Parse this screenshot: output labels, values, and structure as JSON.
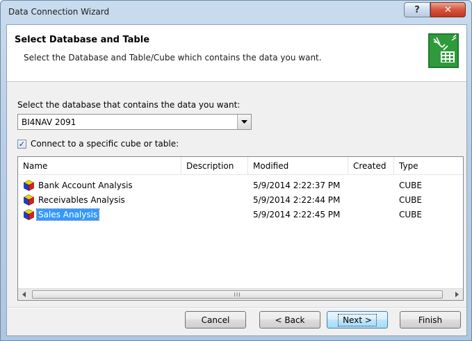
{
  "window": {
    "title": "Data Connection Wizard",
    "help_glyph": "?",
    "close_glyph": "✕"
  },
  "header": {
    "title": "Select Database and Table",
    "subtitle": "Select the Database and Table/Cube which contains the data you want."
  },
  "database": {
    "label": "Select the database that contains the data you want:",
    "selected_value": "BI4NAV 2091"
  },
  "connect_checkbox": {
    "label": "Connect to a specific cube or table:",
    "checked": true,
    "check_glyph": "✓"
  },
  "list": {
    "columns": {
      "name": "Name",
      "description": "Description",
      "modified": "Modified",
      "created": "Created",
      "type": "Type"
    },
    "rows": [
      {
        "name": "Bank Account Analysis",
        "description": "",
        "modified": "5/9/2014 2:22:37 PM",
        "created": "",
        "type": "CUBE"
      },
      {
        "name": "Receivables Analysis",
        "description": "",
        "modified": "5/9/2014 2:22:44 PM",
        "created": "",
        "type": "CUBE"
      },
      {
        "name": "Sales Analysis",
        "description": "",
        "modified": "5/9/2014 2:22:45 PM",
        "created": "",
        "type": "CUBE",
        "selected": true
      }
    ],
    "scroll_grip": "III"
  },
  "buttons": {
    "cancel": "Cancel",
    "back": "< Back",
    "next": "Next >",
    "finish": "Finish"
  },
  "colors": {
    "selection": "#3399ff",
    "title_bar": "#b9cfe6",
    "close_button": "#c2361f",
    "cube_blue": "#1e3cc8",
    "cube_red": "#d81e1e",
    "cube_yellow": "#f5d20a"
  },
  "icons": {
    "header": "data-connection-wizard-icon",
    "row": "cube-icon",
    "dropdown": "chevron-down-icon"
  }
}
